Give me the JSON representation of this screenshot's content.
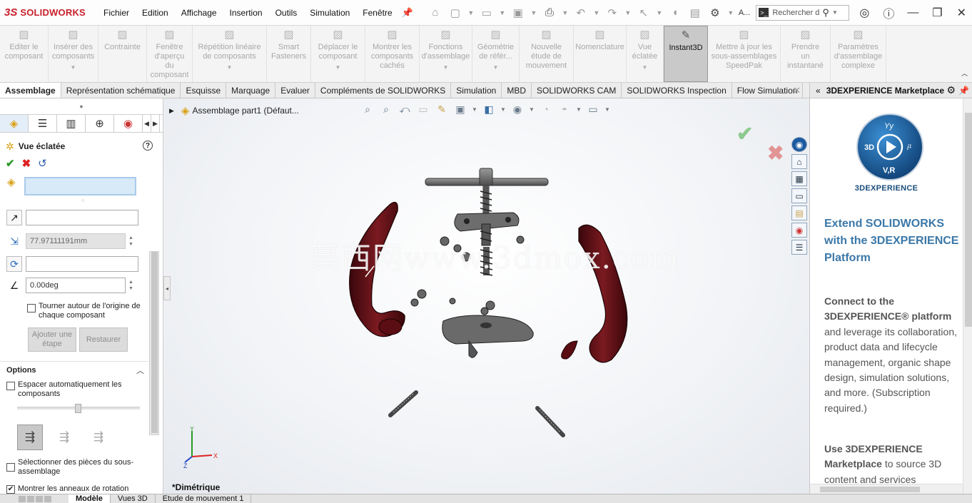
{
  "app": {
    "logo_ds": "3S",
    "logo_text": "SOLIDWORKS"
  },
  "menu": [
    "Fichier",
    "Edition",
    "Affichage",
    "Insertion",
    "Outils",
    "Simulation",
    "Fenêtre"
  ],
  "search": {
    "value": "Rechercher d",
    "truncated_label": "A..."
  },
  "command_manager": [
    {
      "label": "Editer le\ncomposant",
      "icon": "edit-component-icon",
      "active": false
    },
    {
      "label": "Insérer des\ncomposants",
      "icon": "insert-components-icon",
      "active": false,
      "dropdown": true
    },
    {
      "label": "Contrainte",
      "icon": "mate-icon",
      "active": false
    },
    {
      "label": "Fenêtre\nd'aperçu\ndu\ncomposant",
      "icon": "preview-window-icon",
      "active": false
    },
    {
      "label": "Répétition linéaire\nde composants",
      "icon": "linear-pattern-icon",
      "active": false,
      "dropdown": true
    },
    {
      "label": "Smart\nFasteners",
      "icon": "smart-fasteners-icon",
      "active": false
    },
    {
      "label": "Déplacer le\ncomposant",
      "icon": "move-component-icon",
      "active": false,
      "dropdown": true
    },
    {
      "label": "Montrer les\ncomposants\ncachés",
      "icon": "show-hidden-icon",
      "active": false
    },
    {
      "label": "Fonctions\nd'assemblage",
      "icon": "assembly-features-icon",
      "active": false,
      "dropdown": true
    },
    {
      "label": "Géométrie\nde référ...",
      "icon": "reference-geometry-icon",
      "active": false,
      "dropdown": true
    },
    {
      "label": "Nouvelle\nétude de\nmouvement",
      "icon": "motion-study-icon",
      "active": false
    },
    {
      "label": "Nomenclature",
      "icon": "bom-icon",
      "active": false
    },
    {
      "label": "Vue\néclatée",
      "icon": "exploded-view-icon",
      "active": false,
      "dropdown": true
    },
    {
      "label": "Instant3D",
      "icon": "instant3d-icon",
      "active": true
    },
    {
      "label": "Mettre à jour les\nsous-assemblages\nSpeedPak",
      "icon": "speedpak-icon",
      "active": false
    },
    {
      "label": "Prendre\nun\ninstantané",
      "icon": "snapshot-icon",
      "active": false
    },
    {
      "label": "Paramètres\nd'assemblage\ncomplexe",
      "icon": "large-assembly-icon",
      "active": false
    }
  ],
  "tabs": [
    "Assemblage",
    "Représentation schématique",
    "Esquisse",
    "Marquage",
    "Evaluer",
    "Compléments de SOLIDWORKS",
    "Simulation",
    "MBD",
    "SOLIDWORKS CAM",
    "SOLIDWORKS Inspection",
    "Flow Simulation"
  ],
  "active_tab": "Assemblage",
  "property_manager": {
    "title": "Vue éclatée",
    "distance_value": "77.97111191mm",
    "angle_value": "0.00deg",
    "rotate_checkbox_label": "Tourner autour de l'origine de chaque composant",
    "add_step_label": "Ajouter une étape",
    "restore_label": "Restaurer",
    "options_header": "Options",
    "auto_space_label": "Espacer automatiquement les composants",
    "select_subassembly_label": "Sélectionner des pièces du sous-assemblage",
    "show_rotation_rings_label": "Montrer les anneaux de rotation"
  },
  "viewport": {
    "tree_root": "Assemblage part1 (Défaut...",
    "watermark": "莫西网www.3dmox.com",
    "view_name": "*Dimétrique",
    "triad": {
      "y": "Y",
      "x": "X",
      "z": "Z"
    }
  },
  "task_pane": {
    "header": "3DEXPERIENCE Marketplace",
    "brand": "3DEXPERIENCE",
    "logo_letters": {
      "yy": "Yy",
      "threeD": "3D",
      "ii": "i¹",
      "vr": "V,R"
    },
    "title": "Extend SOLIDWORKS with the 3DEXPERIENCE Platform",
    "para1_bold": "Connect to the 3DEXPERIENCE® platform",
    "para1_rest": " and leverage its collaboration, product data and lifecycle management, organic shape design, simulation solutions, and more. (Subscription required.)",
    "para2_bold": "Use 3DEXPERIENCE Marketplace",
    "para2_rest": " to source 3D content and services"
  },
  "bottom_tabs": [
    "Modèle",
    "Vues 3D",
    "Etude de mouvement 1"
  ],
  "bottom_active": "Modèle",
  "colors": {
    "brand_red": "#c8202b",
    "part_dark_red": "#5a0d12",
    "part_gray": "#7a7a7a",
    "accent_blue": "#3b78a8"
  }
}
